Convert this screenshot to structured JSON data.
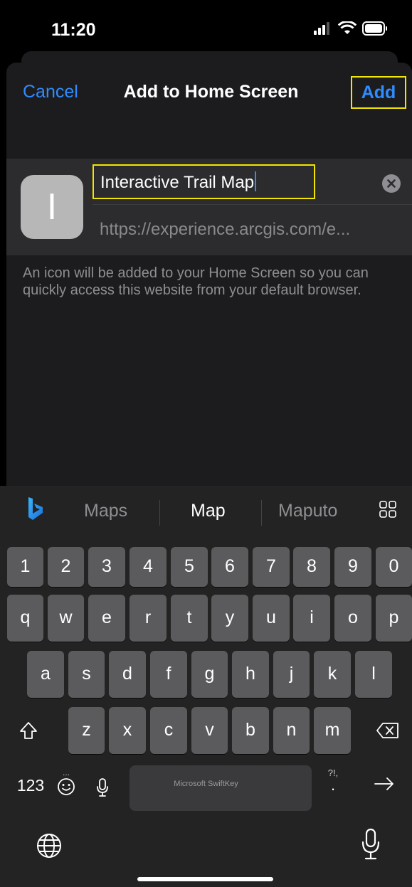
{
  "status_bar": {
    "time": "11:20"
  },
  "nav": {
    "cancel_label": "Cancel",
    "title": "Add to Home Screen",
    "add_label": "Add"
  },
  "form": {
    "icon_letter": "I",
    "name_value": "Interactive Trail Map",
    "url": "https://experience.arcgis.com/e..."
  },
  "help_text": "An icon will be added to your Home Screen so you can quickly access this website from your default browser.",
  "keyboard": {
    "suggestions": [
      "Maps",
      "Map",
      "Maputo"
    ],
    "row_numbers": [
      "1",
      "2",
      "3",
      "4",
      "5",
      "6",
      "7",
      "8",
      "9",
      "0"
    ],
    "row_top": [
      "q",
      "w",
      "e",
      "r",
      "t",
      "y",
      "u",
      "i",
      "o",
      "p"
    ],
    "row_middle": [
      "a",
      "s",
      "d",
      "f",
      "g",
      "h",
      "j",
      "k",
      "l"
    ],
    "row_bottom": [
      "z",
      "x",
      "c",
      "v",
      "b",
      "n",
      "m"
    ],
    "numbers_label": "123",
    "space_label": "Microsoft SwiftKey",
    "punctuation_label": "?!,",
    "emoji_dots": "..."
  },
  "colors": {
    "accent": "#2f8cff",
    "highlight": "#f2e600",
    "sheet": "#1c1c1e",
    "key": "#5b5b5d"
  }
}
